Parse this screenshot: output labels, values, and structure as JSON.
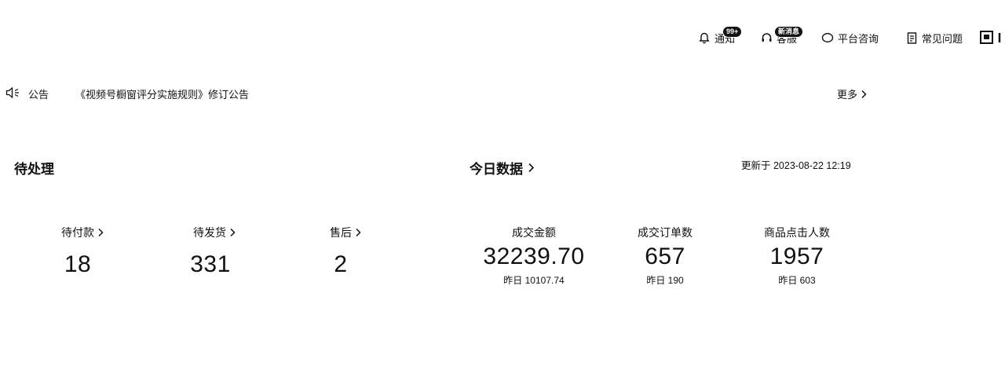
{
  "topbar": {
    "notifications": {
      "label": "通知",
      "badge": "99+"
    },
    "service": {
      "label": "客服",
      "badge": "新消息"
    },
    "consult": {
      "label": "平台咨询"
    },
    "faq": {
      "label": "常见问题"
    }
  },
  "notice": {
    "label": "公告",
    "title": "《视频号橱窗评分实施规则》修订公告",
    "more": "更多"
  },
  "pending": {
    "title": "待处理",
    "items": [
      {
        "label": "待付款",
        "value": "18"
      },
      {
        "label": "待发货",
        "value": "331"
      },
      {
        "label": "售后",
        "value": "2"
      }
    ]
  },
  "today": {
    "title": "今日数据",
    "updated": "更新于 2023-08-22 12:19",
    "items": [
      {
        "label": "成交金额",
        "value": "32239.70",
        "yesterday": "昨日 10107.74"
      },
      {
        "label": "成交订单数",
        "value": "657",
        "yesterday": "昨日 190"
      },
      {
        "label": "商品点击人数",
        "value": "1957",
        "yesterday": "昨日 603"
      }
    ]
  },
  "icons": [
    "bell-icon",
    "headset-icon",
    "chat-bubble-icon",
    "document-icon",
    "avatar-icon",
    "speaker-icon",
    "chevron-right-icon"
  ]
}
